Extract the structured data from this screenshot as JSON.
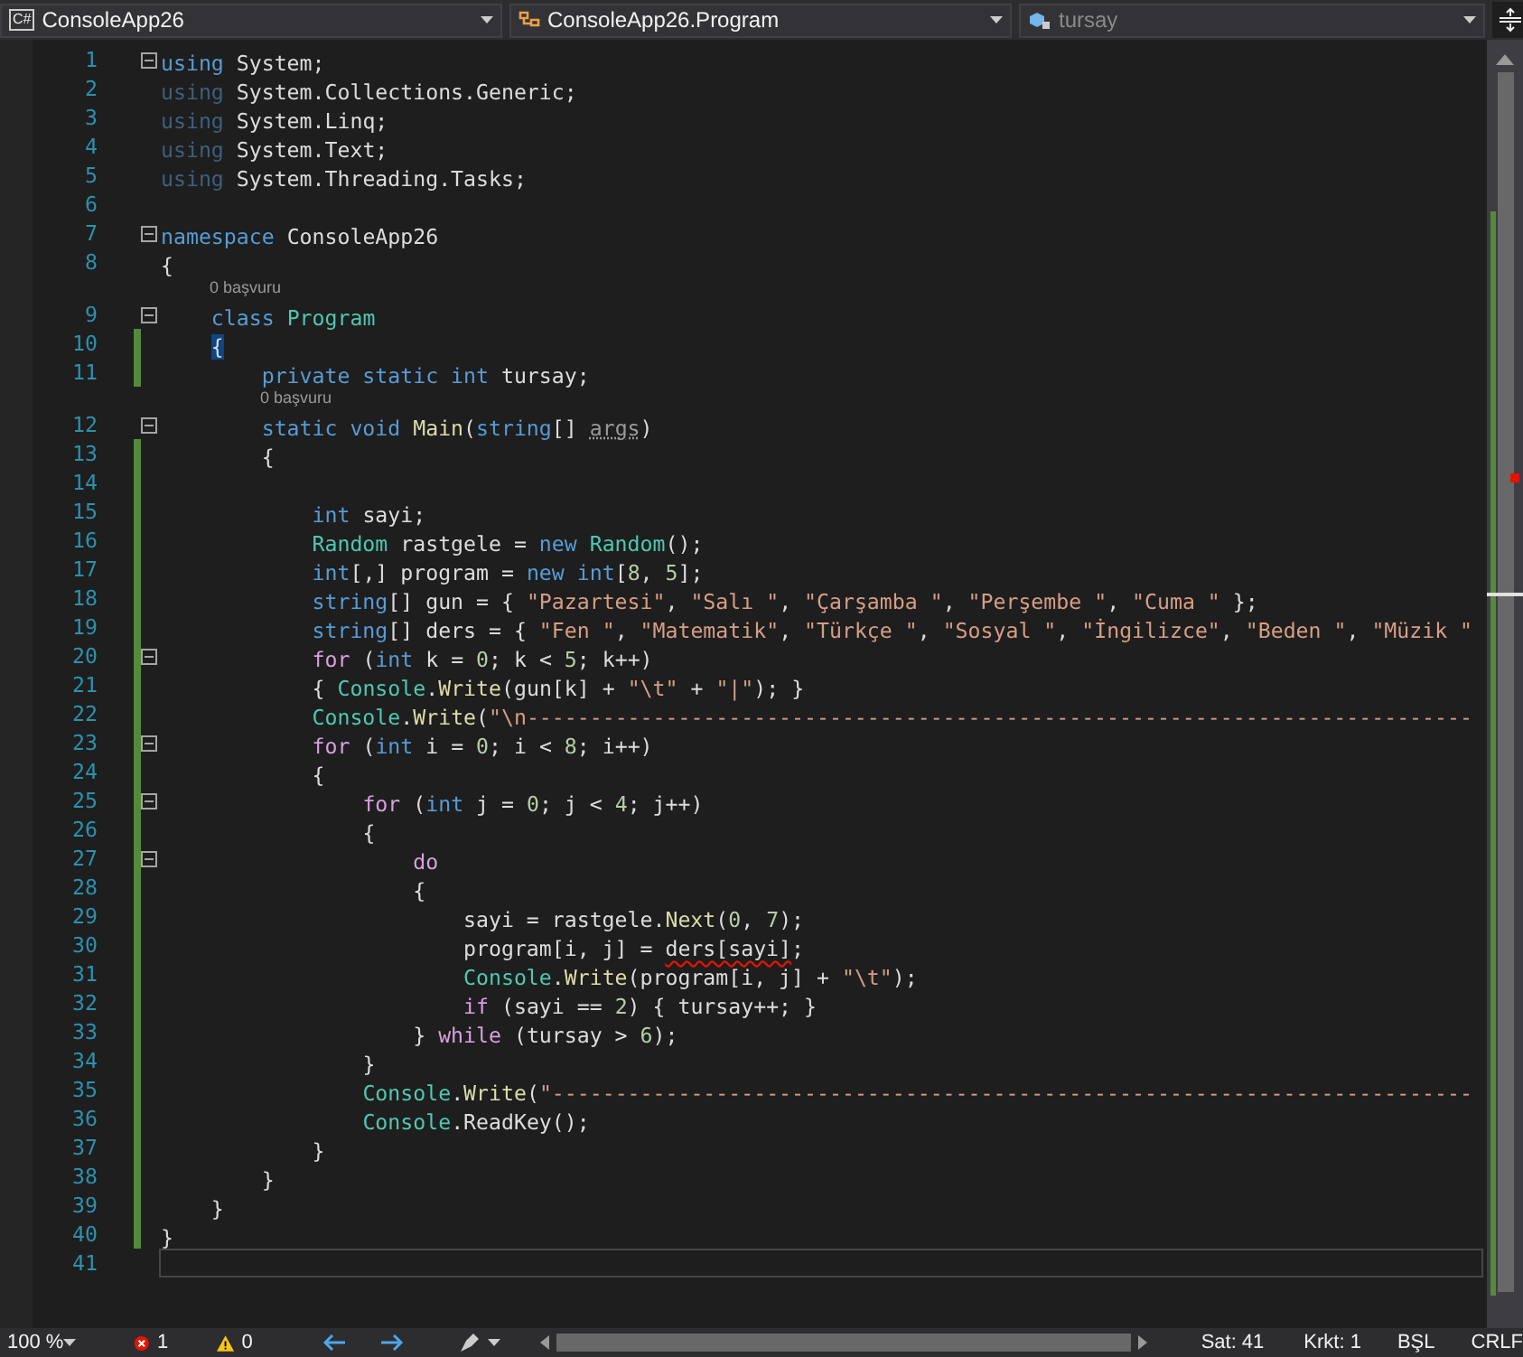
{
  "navbar": {
    "project": {
      "label": "ConsoleApp26",
      "badge": "C#"
    },
    "type": {
      "label": "ConsoleApp26.Program"
    },
    "member": {
      "label": "tursay",
      "disabled": true
    }
  },
  "lines": [
    {
      "number": "1",
      "foldable": true,
      "changed": false,
      "current": false,
      "tokens": [
        {
          "kind": "kw",
          "text": "using"
        },
        {
          "kind": "plain",
          "text": " System;"
        }
      ]
    },
    {
      "number": "2",
      "foldable": false,
      "changed": false,
      "current": false,
      "tokens": [
        {
          "kind": "kwfaded",
          "text": "using"
        },
        {
          "kind": "plain",
          "text": " System.Collections.Generic;"
        }
      ]
    },
    {
      "number": "3",
      "foldable": false,
      "changed": false,
      "current": false,
      "tokens": [
        {
          "kind": "kwfaded",
          "text": "using"
        },
        {
          "kind": "plain",
          "text": " System.Linq;"
        }
      ]
    },
    {
      "number": "4",
      "foldable": false,
      "changed": false,
      "current": false,
      "tokens": [
        {
          "kind": "kwfaded",
          "text": "using"
        },
        {
          "kind": "plain",
          "text": " System.Text;"
        }
      ]
    },
    {
      "number": "5",
      "foldable": false,
      "changed": false,
      "current": false,
      "tokens": [
        {
          "kind": "kwfaded",
          "text": "using"
        },
        {
          "kind": "plain",
          "text": " System.Threading.Tasks;"
        }
      ]
    },
    {
      "number": "6",
      "foldable": false,
      "changed": false,
      "current": false
    },
    {
      "number": "7",
      "foldable": true,
      "changed": false,
      "current": false,
      "tokens": [
        {
          "kind": "kw",
          "text": "namespace"
        },
        {
          "kind": "plain",
          "text": " ConsoleApp26"
        }
      ]
    },
    {
      "number": "8",
      "foldable": false,
      "changed": false,
      "current": false,
      "tokens": [
        {
          "kind": "plain",
          "text": "{"
        }
      ]
    },
    {
      "number": "9",
      "foldable": true,
      "changed": false,
      "current": false,
      "codelens": "0 başvuru",
      "tokens": [
        {
          "kind": "kw",
          "text": "    class "
        },
        {
          "kind": "type",
          "text": "Program"
        }
      ]
    },
    {
      "number": "10",
      "foldable": false,
      "changed": true,
      "current": false,
      "tokens": [
        {
          "kind": "brace",
          "text": "    {"
        }
      ]
    },
    {
      "number": "11",
      "foldable": false,
      "changed": true,
      "current": false,
      "tokens": [
        {
          "kind": "kw",
          "text": "        private static int"
        },
        {
          "kind": "plain",
          "text": " tursay;"
        }
      ]
    },
    {
      "number": "12",
      "foldable": true,
      "changed": false,
      "current": false,
      "codelens": "0 başvuru",
      "tokens": [
        {
          "kind": "kw",
          "text": "        static void "
        },
        {
          "kind": "method",
          "text": "Main"
        },
        {
          "kind": "plain",
          "text": "("
        },
        {
          "kind": "kw",
          "text": "string"
        },
        {
          "kind": "plain",
          "text": "[] "
        },
        {
          "kind": "unused",
          "text": "args"
        },
        {
          "kind": "plain",
          "text": ")"
        }
      ]
    },
    {
      "number": "13",
      "foldable": false,
      "changed": true,
      "current": false,
      "tokens": [
        {
          "kind": "plain",
          "text": "        {"
        }
      ]
    },
    {
      "number": "14",
      "foldable": false,
      "changed": true,
      "current": false
    },
    {
      "number": "15",
      "foldable": false,
      "changed": true,
      "current": false,
      "tokens": [
        {
          "kind": "kw",
          "text": "            int"
        },
        {
          "kind": "plain",
          "text": " sayi;"
        }
      ]
    },
    {
      "number": "16",
      "foldable": false,
      "changed": true,
      "current": false,
      "tokens": [
        {
          "kind": "type",
          "text": "            Random"
        },
        {
          "kind": "plain",
          "text": " rastgele = "
        },
        {
          "kind": "kw",
          "text": "new "
        },
        {
          "kind": "type",
          "text": "Random"
        },
        {
          "kind": "plain",
          "text": "();"
        }
      ]
    },
    {
      "number": "17",
      "foldable": false,
      "changed": true,
      "current": false,
      "tokens": [
        {
          "kind": "kw",
          "text": "            int"
        },
        {
          "kind": "plain",
          "text": "[,] program = "
        },
        {
          "kind": "kw",
          "text": "new int"
        },
        {
          "kind": "plain",
          "text": "["
        },
        {
          "kind": "num",
          "text": "8"
        },
        {
          "kind": "plain",
          "text": ", "
        },
        {
          "kind": "num",
          "text": "5"
        },
        {
          "kind": "plain",
          "text": "];"
        }
      ]
    },
    {
      "number": "18",
      "foldable": false,
      "changed": true,
      "current": false,
      "tokens": [
        {
          "kind": "kw",
          "text": "            string"
        },
        {
          "kind": "plain",
          "text": "[] gun = { "
        },
        {
          "kind": "str",
          "text": "\"Pazartesi\""
        },
        {
          "kind": "plain",
          "text": ", "
        },
        {
          "kind": "str",
          "text": "\"Salı \""
        },
        {
          "kind": "plain",
          "text": ", "
        },
        {
          "kind": "str",
          "text": "\"Çarşamba \""
        },
        {
          "kind": "plain",
          "text": ", "
        },
        {
          "kind": "str",
          "text": "\"Perşembe \""
        },
        {
          "kind": "plain",
          "text": ", "
        },
        {
          "kind": "str",
          "text": "\"Cuma \""
        },
        {
          "kind": "plain",
          "text": " };"
        }
      ]
    },
    {
      "number": "19",
      "foldable": false,
      "changed": true,
      "current": false,
      "tokens": [
        {
          "kind": "kw",
          "text": "            string"
        },
        {
          "kind": "plain",
          "text": "[] ders = { "
        },
        {
          "kind": "str",
          "text": "\"Fen \""
        },
        {
          "kind": "plain",
          "text": ", "
        },
        {
          "kind": "str",
          "text": "\"Matematik\""
        },
        {
          "kind": "plain",
          "text": ", "
        },
        {
          "kind": "str",
          "text": "\"Türkçe \""
        },
        {
          "kind": "plain",
          "text": ", "
        },
        {
          "kind": "str",
          "text": "\"Sosyal \""
        },
        {
          "kind": "plain",
          "text": ", "
        },
        {
          "kind": "str",
          "text": "\"İngilizce\""
        },
        {
          "kind": "plain",
          "text": ", "
        },
        {
          "kind": "str",
          "text": "\"Beden \""
        },
        {
          "kind": "plain",
          "text": ", "
        },
        {
          "kind": "str",
          "text": "\"Müzik \""
        }
      ]
    },
    {
      "number": "20",
      "foldable": true,
      "changed": true,
      "current": false,
      "tokens": [
        {
          "kind": "ctl",
          "text": "            for"
        },
        {
          "kind": "plain",
          "text": " ("
        },
        {
          "kind": "kw",
          "text": "int"
        },
        {
          "kind": "plain",
          "text": " k = "
        },
        {
          "kind": "num",
          "text": "0"
        },
        {
          "kind": "plain",
          "text": "; k < "
        },
        {
          "kind": "num",
          "text": "5"
        },
        {
          "kind": "plain",
          "text": "; k++)"
        }
      ]
    },
    {
      "number": "21",
      "foldable": false,
      "changed": true,
      "current": false,
      "tokens": [
        {
          "kind": "plain",
          "text": "            { "
        },
        {
          "kind": "type",
          "text": "Console"
        },
        {
          "kind": "plain",
          "text": "."
        },
        {
          "kind": "method",
          "text": "Write"
        },
        {
          "kind": "plain",
          "text": "(gun[k] + "
        },
        {
          "kind": "str",
          "text": "\"\\t\""
        },
        {
          "kind": "plain",
          "text": " + "
        },
        {
          "kind": "str",
          "text": "\"|\""
        },
        {
          "kind": "plain",
          "text": "); }"
        }
      ]
    },
    {
      "number": "22",
      "foldable": false,
      "changed": true,
      "current": false,
      "tokens": [
        {
          "kind": "type",
          "text": "            Console"
        },
        {
          "kind": "plain",
          "text": "."
        },
        {
          "kind": "method",
          "text": "Write"
        },
        {
          "kind": "plain",
          "text": "("
        },
        {
          "kind": "str",
          "text": "\"\\n---------------------------------------------------------------------------"
        }
      ]
    },
    {
      "number": "23",
      "foldable": true,
      "changed": true,
      "current": false,
      "tokens": [
        {
          "kind": "ctl",
          "text": "            for"
        },
        {
          "kind": "plain",
          "text": " ("
        },
        {
          "kind": "kw",
          "text": "int"
        },
        {
          "kind": "plain",
          "text": " i = "
        },
        {
          "kind": "num",
          "text": "0"
        },
        {
          "kind": "plain",
          "text": "; i < "
        },
        {
          "kind": "num",
          "text": "8"
        },
        {
          "kind": "plain",
          "text": "; i++)"
        }
      ]
    },
    {
      "number": "24",
      "foldable": false,
      "changed": true,
      "current": false,
      "tokens": [
        {
          "kind": "plain",
          "text": "            {"
        }
      ]
    },
    {
      "number": "25",
      "foldable": true,
      "changed": true,
      "current": false,
      "tokens": [
        {
          "kind": "ctl",
          "text": "                for"
        },
        {
          "kind": "plain",
          "text": " ("
        },
        {
          "kind": "kw",
          "text": "int"
        },
        {
          "kind": "plain",
          "text": " j = "
        },
        {
          "kind": "num",
          "text": "0"
        },
        {
          "kind": "plain",
          "text": "; j < "
        },
        {
          "kind": "num",
          "text": "4"
        },
        {
          "kind": "plain",
          "text": "; j++)"
        }
      ]
    },
    {
      "number": "26",
      "foldable": false,
      "changed": true,
      "current": false,
      "tokens": [
        {
          "kind": "plain",
          "text": "                {"
        }
      ]
    },
    {
      "number": "27",
      "foldable": true,
      "changed": true,
      "current": false,
      "tokens": [
        {
          "kind": "ctl",
          "text": "                    do"
        }
      ]
    },
    {
      "number": "28",
      "foldable": false,
      "changed": true,
      "current": false,
      "tokens": [
        {
          "kind": "plain",
          "text": "                    {"
        }
      ]
    },
    {
      "number": "29",
      "foldable": false,
      "changed": true,
      "current": false,
      "tokens": [
        {
          "kind": "plain",
          "text": "                        sayi = rastgele."
        },
        {
          "kind": "method",
          "text": "Next"
        },
        {
          "kind": "plain",
          "text": "("
        },
        {
          "kind": "num",
          "text": "0"
        },
        {
          "kind": "plain",
          "text": ", "
        },
        {
          "kind": "num",
          "text": "7"
        },
        {
          "kind": "plain",
          "text": ");"
        }
      ]
    },
    {
      "number": "30",
      "foldable": false,
      "changed": true,
      "current": false,
      "tokens": [
        {
          "kind": "plain",
          "text": "                        program[i, j] = "
        },
        {
          "kind": "error",
          "text": "ders[sayi]"
        },
        {
          "kind": "plain",
          "text": ";"
        }
      ]
    },
    {
      "number": "31",
      "foldable": false,
      "changed": true,
      "current": false,
      "tokens": [
        {
          "kind": "type",
          "text": "                        Console"
        },
        {
          "kind": "plain",
          "text": "."
        },
        {
          "kind": "method",
          "text": "Write"
        },
        {
          "kind": "plain",
          "text": "(program[i, j] + "
        },
        {
          "kind": "str",
          "text": "\"\\t\""
        },
        {
          "kind": "plain",
          "text": ");"
        }
      ]
    },
    {
      "number": "32",
      "foldable": false,
      "changed": true,
      "current": false,
      "tokens": [
        {
          "kind": "ctl",
          "text": "                        if"
        },
        {
          "kind": "plain",
          "text": " (sayi == "
        },
        {
          "kind": "num",
          "text": "2"
        },
        {
          "kind": "plain",
          "text": ") { tursay++; }"
        }
      ]
    },
    {
      "number": "33",
      "foldable": false,
      "changed": true,
      "current": false,
      "tokens": [
        {
          "kind": "plain",
          "text": "                    } "
        },
        {
          "kind": "ctl",
          "text": "while"
        },
        {
          "kind": "plain",
          "text": " (tursay > "
        },
        {
          "kind": "num",
          "text": "6"
        },
        {
          "kind": "plain",
          "text": ");"
        }
      ]
    },
    {
      "number": "34",
      "foldable": false,
      "changed": true,
      "current": false,
      "tokens": [
        {
          "kind": "plain",
          "text": "                }"
        }
      ]
    },
    {
      "number": "35",
      "foldable": false,
      "changed": true,
      "current": false,
      "tokens": [
        {
          "kind": "type",
          "text": "                Console"
        },
        {
          "kind": "plain",
          "text": "."
        },
        {
          "kind": "method",
          "text": "Write"
        },
        {
          "kind": "plain",
          "text": "("
        },
        {
          "kind": "str",
          "text": "\"-------------------------------------------------------------------------"
        }
      ]
    },
    {
      "number": "36",
      "foldable": false,
      "changed": true,
      "current": false,
      "tokens": [
        {
          "kind": "type",
          "text": "                Console"
        },
        {
          "kind": "plain",
          "text": ".ReadKey"
        },
        {
          "kind": "plain",
          "text": "();"
        }
      ]
    },
    {
      "number": "37",
      "foldable": false,
      "changed": true,
      "current": false,
      "tokens": [
        {
          "kind": "plain",
          "text": "            }"
        }
      ]
    },
    {
      "number": "38",
      "foldable": false,
      "changed": true,
      "current": false,
      "tokens": [
        {
          "kind": "plain",
          "text": "        }"
        }
      ]
    },
    {
      "number": "39",
      "foldable": false,
      "changed": true,
      "current": false,
      "tokens": [
        {
          "kind": "plain",
          "text": "    }"
        }
      ]
    },
    {
      "number": "40",
      "foldable": false,
      "changed": true,
      "current": false,
      "tokens": [
        {
          "kind": "plain",
          "text": "}"
        }
      ]
    },
    {
      "number": "41",
      "foldable": false,
      "changed": false,
      "current": true
    }
  ],
  "status_bar": {
    "zoom": "100 %",
    "errors": "1",
    "warnings": "0",
    "line": "Sat: 41",
    "column": "Krkt: 1",
    "insert_mode": "BŞL",
    "line_ending": "CRLF"
  }
}
